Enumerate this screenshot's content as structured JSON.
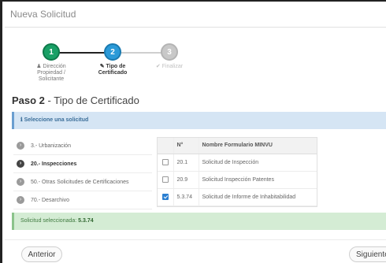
{
  "modal": {
    "title": "Nueva Solicitud"
  },
  "wizard": {
    "steps": [
      {
        "number": "1",
        "icon": "user-icon",
        "icon_glyph": "♟",
        "label_lines": [
          "Dirección",
          "Propiedad /",
          "Solicitante"
        ],
        "state": "done"
      },
      {
        "number": "2",
        "icon": "edit-icon",
        "icon_glyph": "✎",
        "label_lines": [
          "Tipo de",
          "Certificado"
        ],
        "state": "active"
      },
      {
        "number": "3",
        "icon": "check-icon",
        "icon_glyph": "✔",
        "label_lines": [
          "Finalizar"
        ],
        "state": "pending"
      }
    ]
  },
  "paso": {
    "prefix": "Paso 2",
    "suffix": " - Tipo de Certificado"
  },
  "alert_info": {
    "icon_glyph": "ℹ",
    "text": "Seleccione una solicitud"
  },
  "options": [
    {
      "label": "3.- Urbanización",
      "selected": false
    },
    {
      "label": "20.- Inspecciones",
      "selected": true
    },
    {
      "label": "50.- Otras Solicitudes de Certificaciones",
      "selected": false
    },
    {
      "label": "70.- Desarchivo",
      "selected": false
    }
  ],
  "table": {
    "headers": {
      "check": "",
      "number": "N°",
      "name": "Nombre Formulario MINVU"
    },
    "rows": [
      {
        "checked": false,
        "number": "20.1",
        "name": "Solicitud de Inspección"
      },
      {
        "checked": false,
        "number": "20.9",
        "name": "Solicitud Inspección Patentes"
      },
      {
        "checked": true,
        "number": "5.3.74",
        "name": "Solicitud de Informe de Inhabitabilidad"
      }
    ]
  },
  "alert_success": {
    "prefix": "Solicitud seleccionada: ",
    "value": "5.3.74"
  },
  "footer": {
    "prev_label": "Anterior",
    "next_label": "Siguiente"
  },
  "colors": {
    "done": "#19a066",
    "active": "#2b9ad8",
    "pending": "#c8c8c8",
    "info_bg": "#d5e5f4",
    "success_bg": "#d4ecd4"
  }
}
